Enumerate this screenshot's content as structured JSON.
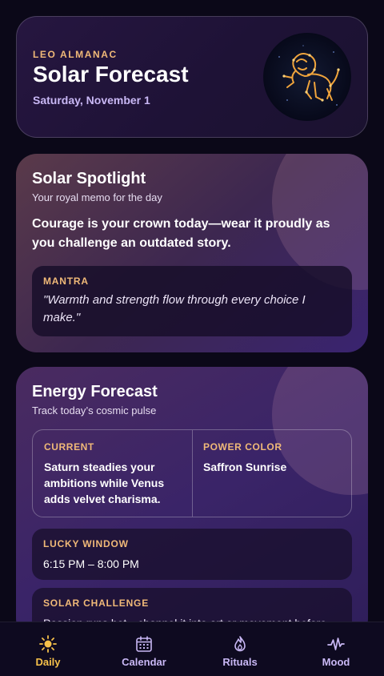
{
  "header": {
    "eyebrow": "LEO ALMANAC",
    "title": "Solar Forecast",
    "date": "Saturday, November 1",
    "emblem_icon": "leo-lion-constellation-icon"
  },
  "spotlight": {
    "title": "Solar Spotlight",
    "subtitle": "Your royal memo for the day",
    "message": "Courage is your crown today—wear it proudly as you challenge an outdated story.",
    "mantra_label": "MANTRA",
    "mantra": "\"Warmth and strength flow through every choice I make.\""
  },
  "energy": {
    "title": "Energy Forecast",
    "subtitle": "Track today’s cosmic pulse",
    "current_label": "CURRENT",
    "current_value": "Saturn steadies your ambitions while Venus adds velvet charisma.",
    "power_color_label": "POWER COLOR",
    "power_color_value": "Saffron Sunrise",
    "lucky_window_label": "LUCKY WINDOW",
    "lucky_window_value": "6:15 PM – 8:00 PM",
    "challenge_label": "SOLAR CHALLENGE",
    "challenge_value": "Passion runs hot—channel it into art or movement before"
  },
  "nav": {
    "items": [
      {
        "label": "Daily",
        "icon": "sun-icon",
        "active": true
      },
      {
        "label": "Calendar",
        "icon": "calendar-icon",
        "active": false
      },
      {
        "label": "Rituals",
        "icon": "flame-icon",
        "active": false
      },
      {
        "label": "Mood",
        "icon": "pulse-icon",
        "active": false
      }
    ]
  },
  "colors": {
    "accent": "#f0b978",
    "active_nav": "#f5c04a",
    "inactive_nav": "#c9b8f5",
    "background": "#0b0818"
  }
}
